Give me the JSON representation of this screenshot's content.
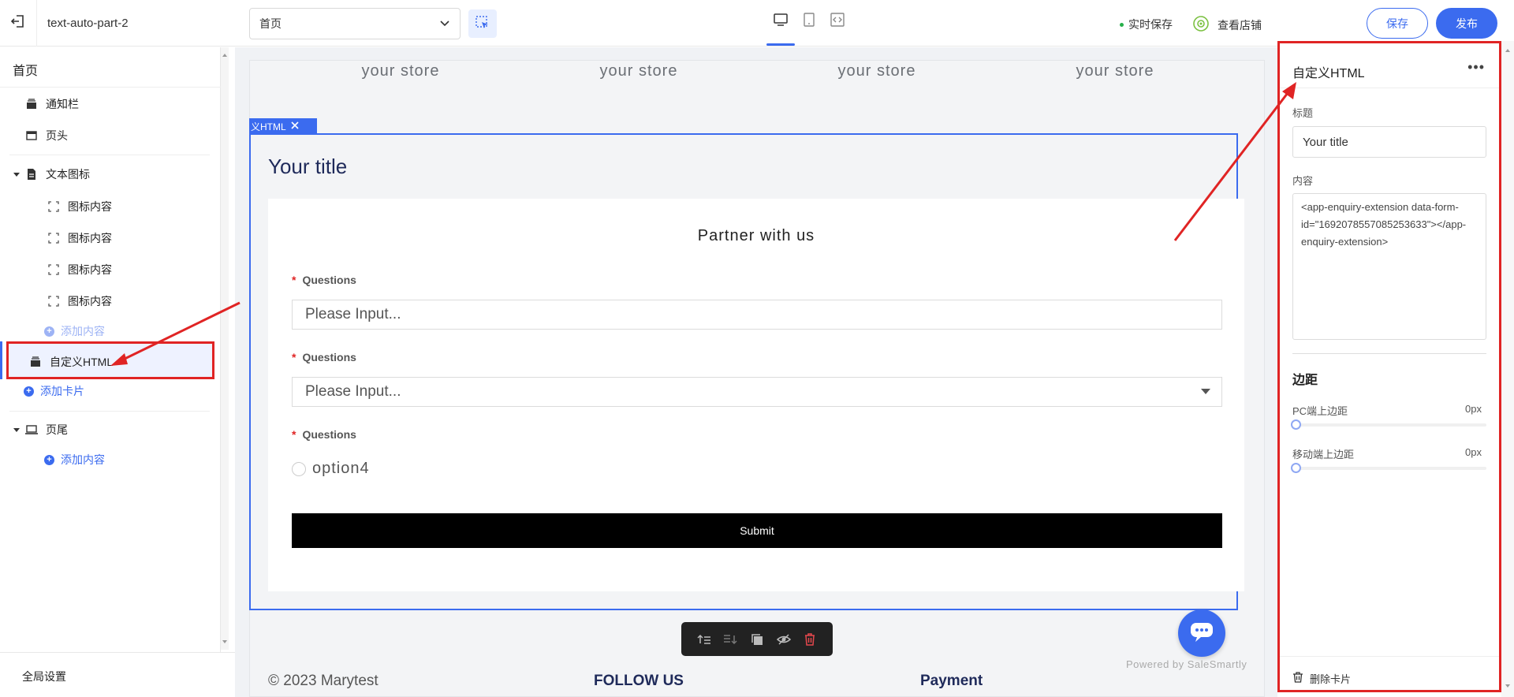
{
  "topbar": {
    "app_name": "text-auto-part-2",
    "page_select_value": "首页",
    "realtime_save": "实时保存",
    "view_store": "查看店铺",
    "save_label": "保存",
    "publish_label": "发布"
  },
  "sidebar": {
    "page_title": "首页",
    "items": {
      "notice_bar": "通知栏",
      "header": "页头",
      "text_icon": "文本图标",
      "icon_content_1": "图标内容",
      "icon_content_2": "图标内容",
      "icon_content_3": "图标内容",
      "icon_content_4": "图标内容",
      "add_content_faded": "添加内容",
      "custom_html": "自定义HTML",
      "add_card": "添加卡片",
      "footer": "页尾",
      "add_content": "添加内容"
    },
    "global_settings": "全局设置"
  },
  "preview": {
    "store_labels": [
      "your store",
      "your store",
      "your store",
      "your store"
    ],
    "section_tag": "义HTML",
    "section_title": "Your title",
    "form": {
      "heading": "Partner with us",
      "questions": [
        {
          "label": "Questions",
          "placeholder": "Please Input..."
        },
        {
          "label": "Questions",
          "placeholder": "Please Input..."
        },
        {
          "label": "Questions",
          "option": "option4"
        }
      ],
      "submit_label": "Submit"
    },
    "powered_by": "Powered by SaleSmartly",
    "footer_copyright": "© 2023 Marytest",
    "footer_follow": "FOLLOW US",
    "footer_payment": "Payment"
  },
  "panel": {
    "title": "自定义HTML",
    "title_field_label": "标题",
    "title_field_value": "Your title",
    "content_label": "内容",
    "content_value": "<app-enquiry-extension data-form-id=\"1692078557085253633\"></app-enquiry-extension>",
    "spacing_heading": "边距",
    "pc_top_spacing_label": "PC端上边距",
    "pc_top_spacing_value": "0px",
    "mobile_top_spacing_label": "移动端上边距",
    "mobile_top_spacing_value": "0px",
    "delete_card": "删除卡片"
  },
  "colors": {
    "accent": "#3b6bef",
    "annotation_red": "#e02424",
    "status_green": "#26b04a"
  }
}
